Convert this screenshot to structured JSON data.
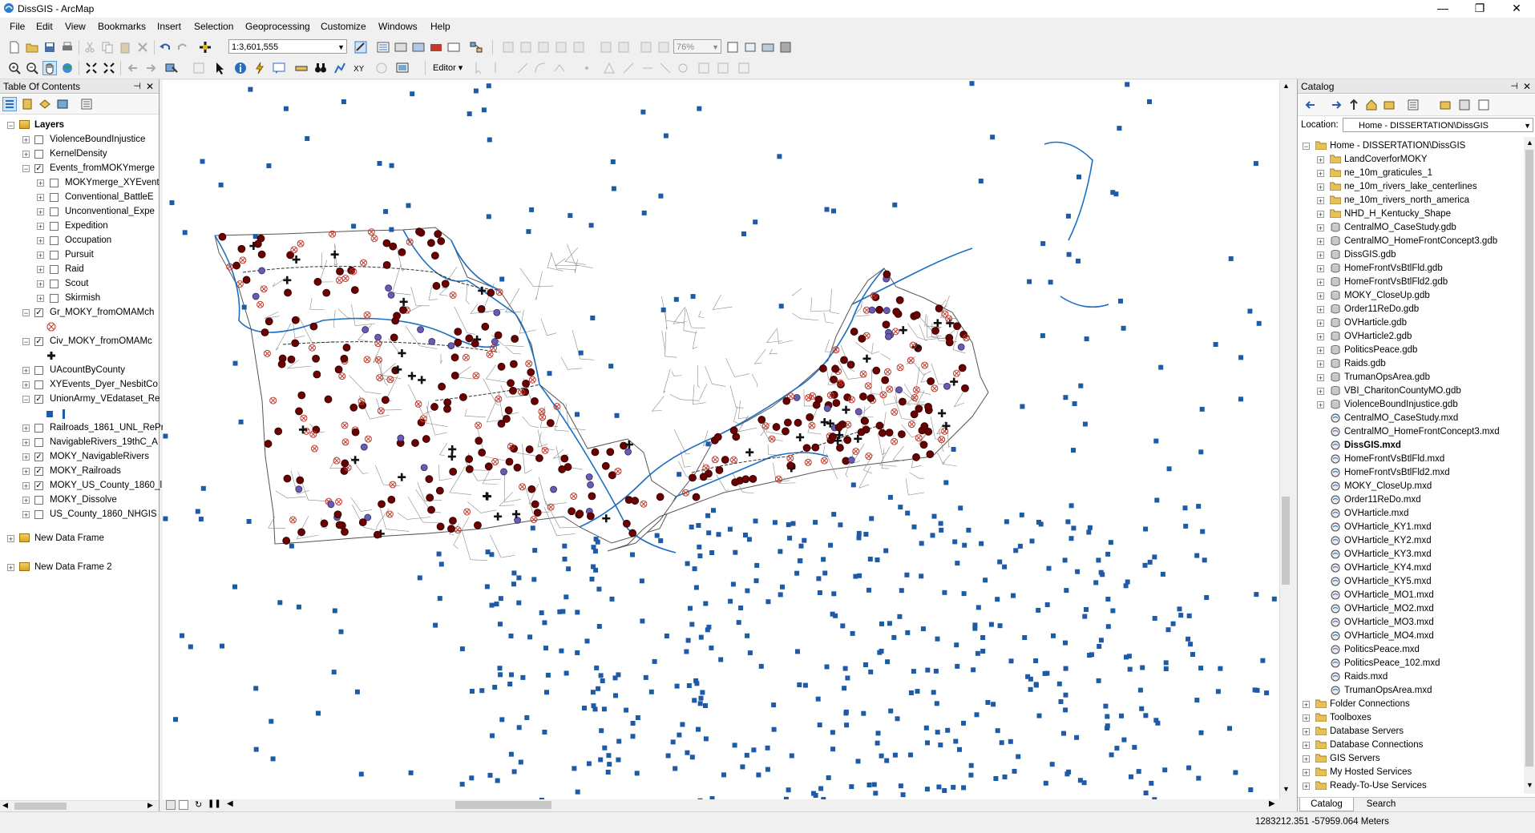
{
  "window": {
    "title": "DissGIS - ArcMap",
    "minimize": "—",
    "maximize": "❐",
    "close": "✕"
  },
  "menu": [
    "File",
    "Edit",
    "View",
    "Bookmarks",
    "Insert",
    "Selection",
    "Geoprocessing",
    "Customize",
    "Windows",
    "Help"
  ],
  "toolbar": {
    "scale": "1:3,601,555",
    "zoom_percent": "76%",
    "editor_label": "Editor"
  },
  "toc": {
    "title": "Table Of Contents",
    "root": "Layers",
    "layers": [
      {
        "label": "ViolenceBoundInjustice",
        "checked": false,
        "level": 1
      },
      {
        "label": "KernelDensity",
        "checked": false,
        "level": 1
      },
      {
        "label": "Events_fromMOKYmerge",
        "checked": true,
        "level": 1,
        "expanded": true
      },
      {
        "label": "MOKYmerge_XYEvent",
        "checked": false,
        "level": 2
      },
      {
        "label": "Conventional_BattleE",
        "checked": false,
        "level": 2
      },
      {
        "label": "Unconventional_Expe",
        "checked": false,
        "level": 2
      },
      {
        "label": "Expedition",
        "checked": false,
        "level": 2
      },
      {
        "label": "Occupation",
        "checked": false,
        "level": 2
      },
      {
        "label": "Pursuit",
        "checked": false,
        "level": 2
      },
      {
        "label": "Raid",
        "checked": false,
        "level": 2
      },
      {
        "label": "Scout",
        "checked": false,
        "level": 2
      },
      {
        "label": "Skirmish",
        "checked": false,
        "level": 2
      },
      {
        "label": "Gr_MOKY_fromOMAMch",
        "checked": true,
        "level": 1,
        "expanded": true
      },
      {
        "label": "Civ_MOKY_fromOMAMc",
        "checked": true,
        "level": 1,
        "expanded": true
      },
      {
        "label": "UAcountByCounty",
        "checked": false,
        "level": 1
      },
      {
        "label": "XYEvents_Dyer_NesbitCo",
        "checked": false,
        "level": 1
      },
      {
        "label": "UnionArmy_VEdataset_Re",
        "checked": true,
        "level": 1,
        "expanded": true
      },
      {
        "label": "Railroads_1861_UNL_RePr",
        "checked": false,
        "level": 1
      },
      {
        "label": "NavigableRivers_19thC_A",
        "checked": false,
        "level": 1
      },
      {
        "label": "MOKY_NavigableRivers",
        "checked": true,
        "level": 1
      },
      {
        "label": "MOKY_Railroads",
        "checked": true,
        "level": 1
      },
      {
        "label": "MOKY_US_County_1860_l",
        "checked": true,
        "level": 1
      },
      {
        "label": "MOKY_Dissolve",
        "checked": false,
        "level": 1
      },
      {
        "label": "US_County_1860_NHGIS",
        "checked": false,
        "level": 1
      }
    ],
    "frames": [
      "New Data Frame",
      "New Data Frame 2"
    ]
  },
  "catalog": {
    "title": "Catalog",
    "location_label": "Location:",
    "location_value": "Home - DISSERTATION\\DissGIS",
    "home": "Home - DISSERTATION\\DissGIS",
    "children": [
      {
        "label": "LandCoverforMOKY",
        "icon": "folder-icon"
      },
      {
        "label": "ne_10m_graticules_1",
        "icon": "folder-icon"
      },
      {
        "label": "ne_10m_rivers_lake_centerlines",
        "icon": "folder-icon"
      },
      {
        "label": "ne_10m_rivers_north_america",
        "icon": "folder-icon"
      },
      {
        "label": "NHD_H_Kentucky_Shape",
        "icon": "folder-icon"
      },
      {
        "label": "CentralMO_CaseStudy.gdb",
        "icon": "geodatabase-icon"
      },
      {
        "label": "CentralMO_HomeFrontConcept3.gdb",
        "icon": "geodatabase-icon"
      },
      {
        "label": "DissGIS.gdb",
        "icon": "geodatabase-icon"
      },
      {
        "label": "HomeFrontVsBtlFld.gdb",
        "icon": "geodatabase-icon"
      },
      {
        "label": "HomeFrontVsBtlFld2.gdb",
        "icon": "geodatabase-icon"
      },
      {
        "label": "MOKY_CloseUp.gdb",
        "icon": "geodatabase-icon"
      },
      {
        "label": "Order11ReDo.gdb",
        "icon": "geodatabase-icon"
      },
      {
        "label": "OVHarticle.gdb",
        "icon": "geodatabase-icon"
      },
      {
        "label": "OVHarticle2.gdb",
        "icon": "geodatabase-icon"
      },
      {
        "label": "PoliticsPeace.gdb",
        "icon": "geodatabase-icon"
      },
      {
        "label": "Raids.gdb",
        "icon": "geodatabase-icon"
      },
      {
        "label": "TrumanOpsArea.gdb",
        "icon": "geodatabase-icon"
      },
      {
        "label": "VBI_CharitonCountyMO.gdb",
        "icon": "geodatabase-icon"
      },
      {
        "label": "ViolenceBoundInjustice.gdb",
        "icon": "geodatabase-icon"
      },
      {
        "label": "CentralMO_CaseStudy.mxd",
        "icon": "map-document-icon"
      },
      {
        "label": "CentralMO_HomeFrontConcept3.mxd",
        "icon": "map-document-icon"
      },
      {
        "label": "DissGIS.mxd",
        "icon": "map-document-icon",
        "bold": true
      },
      {
        "label": "HomeFrontVsBtlFld.mxd",
        "icon": "map-document-icon"
      },
      {
        "label": "HomeFrontVsBtlFld2.mxd",
        "icon": "map-document-icon"
      },
      {
        "label": "MOKY_CloseUp.mxd",
        "icon": "map-document-icon"
      },
      {
        "label": "Order11ReDo.mxd",
        "icon": "map-document-icon"
      },
      {
        "label": "OVHarticle.mxd",
        "icon": "map-document-icon"
      },
      {
        "label": "OVHarticle_KY1.mxd",
        "icon": "map-document-icon"
      },
      {
        "label": "OVHarticle_KY2.mxd",
        "icon": "map-document-icon"
      },
      {
        "label": "OVHarticle_KY3.mxd",
        "icon": "map-document-icon"
      },
      {
        "label": "OVHarticle_KY4.mxd",
        "icon": "map-document-icon"
      },
      {
        "label": "OVHarticle_KY5.mxd",
        "icon": "map-document-icon"
      },
      {
        "label": "OVHarticle_MO1.mxd",
        "icon": "map-document-icon"
      },
      {
        "label": "OVHarticle_MO2.mxd",
        "icon": "map-document-icon"
      },
      {
        "label": "OVHarticle_MO3.mxd",
        "icon": "map-document-icon"
      },
      {
        "label": "OVHarticle_MO4.mxd",
        "icon": "map-document-icon"
      },
      {
        "label": "PoliticsPeace.mxd",
        "icon": "map-document-icon"
      },
      {
        "label": "PoliticsPeace_102.mxd",
        "icon": "map-document-icon"
      },
      {
        "label": "Raids.mxd",
        "icon": "map-document-icon"
      },
      {
        "label": "TrumanOpsArea.mxd",
        "icon": "map-document-icon"
      }
    ],
    "roots": [
      "Folder Connections",
      "Toolboxes",
      "Database Servers",
      "Database Connections",
      "GIS Servers",
      "My Hosted Services",
      "Ready-To-Use Services"
    ],
    "tabs": [
      "Catalog",
      "Search"
    ]
  },
  "status": {
    "coordinates": "1283212.351  -57959.064 Meters"
  },
  "colors": {
    "point_blue": "#1f5aa6",
    "event_dark_red": "#6b0000",
    "river_blue": "#1b6fc2",
    "county_line": "#8a8a8a"
  }
}
